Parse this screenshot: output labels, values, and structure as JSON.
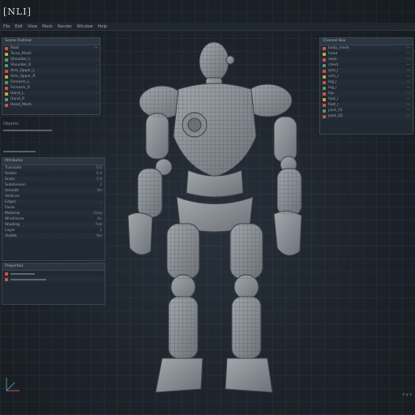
{
  "app": {
    "title": "[NLI]"
  },
  "menubar": {
    "items": [
      "File",
      "Edit",
      "View",
      "Mesh",
      "Render",
      "Window",
      "Help"
    ]
  },
  "left_panel_top": {
    "header": "Scene Outliner",
    "rows": [
      {
        "label": "Root",
        "value": "•",
        "color": "#d05050"
      },
      {
        "label": "Torso_Mesh",
        "value": "·",
        "color": "#c7a642"
      },
      {
        "label": "Shoulder_L",
        "value": "·",
        "color": "#4f9d6a"
      },
      {
        "label": "Shoulder_R",
        "value": "·",
        "color": "#4f9d6a"
      },
      {
        "label": "Arm_Upper_L",
        "value": "·",
        "color": "#d05050"
      },
      {
        "label": "Arm_Upper_R",
        "value": "·",
        "color": "#c7a642"
      },
      {
        "label": "Forearm_L",
        "value": "·",
        "color": "#4f9d6a"
      },
      {
        "label": "Forearm_R",
        "value": "·",
        "color": "#d05050"
      },
      {
        "label": "Hand_L",
        "value": "·",
        "color": "#c7a642"
      },
      {
        "label": "Hand_R",
        "value": "·",
        "color": "#4f9d6a"
      },
      {
        "label": "Head_Mesh",
        "value": "·",
        "color": "#d05050"
      }
    ],
    "footer": "Objects"
  },
  "left_panel_bottom": {
    "header": "Attributes",
    "rows": [
      {
        "label": "Translate",
        "value": "0.0"
      },
      {
        "label": "Rotate",
        "value": "0.0"
      },
      {
        "label": "Scale",
        "value": "1.0"
      },
      {
        "label": "Subdivision",
        "value": "2"
      },
      {
        "label": "Smooth",
        "value": "On"
      },
      {
        "label": "Vertices",
        "value": "-"
      },
      {
        "label": "Edges",
        "value": "-"
      },
      {
        "label": "Faces",
        "value": "-"
      },
      {
        "label": "Material",
        "value": "Grey"
      },
      {
        "label": "Wireframe",
        "value": "On"
      },
      {
        "label": "Shading",
        "value": "Flat"
      },
      {
        "label": "Layer",
        "value": "1"
      },
      {
        "label": "Visible",
        "value": "Yes"
      }
    ],
    "footer": "Properties"
  },
  "right_panel": {
    "header": "Channel Box",
    "rows": [
      {
        "label": "body_mesh",
        "value": "—",
        "color": "#d05050"
      },
      {
        "label": "head",
        "value": "—",
        "color": "#c7a642"
      },
      {
        "label": "neck",
        "value": "—",
        "color": "#d05050"
      },
      {
        "label": "chest",
        "value": "—",
        "color": "#4f9d6a"
      },
      {
        "label": "arm_l",
        "value": "—",
        "color": "#d05050"
      },
      {
        "label": "arm_r",
        "value": "—",
        "color": "#c7a642"
      },
      {
        "label": "leg_l",
        "value": "—",
        "color": "#d05050"
      },
      {
        "label": "leg_r",
        "value": "—",
        "color": "#4f9d6a"
      },
      {
        "label": "hip",
        "value": "—",
        "color": "#d05050"
      },
      {
        "label": "foot_l",
        "value": "—",
        "color": "#c7a642"
      },
      {
        "label": "foot_r",
        "value": "—",
        "color": "#d05050"
      },
      {
        "label": "joint_01",
        "value": "—",
        "color": "#4f9d6a"
      },
      {
        "label": "joint_02",
        "value": "—",
        "color": "#d05050"
      }
    ]
  },
  "status": {
    "coords": "x y z"
  },
  "colors": {
    "accent": "#d05050",
    "background": "#1b2128",
    "panel": "#222a33"
  }
}
